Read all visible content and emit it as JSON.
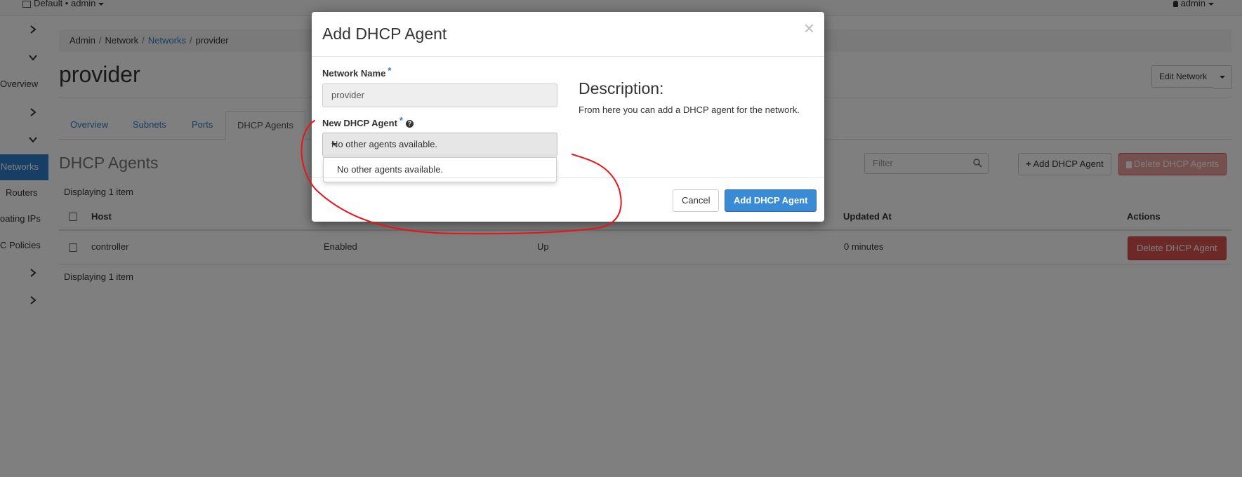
{
  "topbar": {
    "project": "Default • admin",
    "user": "admin"
  },
  "sidebar": {
    "items": [
      {
        "label": "Overview"
      },
      {
        "label": "Networks"
      },
      {
        "label": "Routers"
      },
      {
        "label": "oating IPs"
      },
      {
        "label": "C Policies"
      }
    ]
  },
  "breadcrumb": {
    "items": [
      "Admin",
      "Network",
      "Networks",
      "provider"
    ]
  },
  "page": {
    "title": "provider",
    "edit_button": "Edit Network"
  },
  "tabs": [
    "Overview",
    "Subnets",
    "Ports",
    "DHCP Agents"
  ],
  "section": {
    "title": "DHCP Agents",
    "filter_placeholder": "Filter",
    "add_button": "Add DHCP Agent",
    "delete_button": "Delete DHCP Agents",
    "count_top": "Displaying 1 item",
    "count_bottom": "Displaying 1 item"
  },
  "table": {
    "headers": {
      "host": "Host",
      "updated": "Updated At",
      "actions": "Actions"
    },
    "rows": [
      {
        "host": "controller",
        "status": "Enabled",
        "state": "Up",
        "updated": "0 minutes",
        "action": "Delete DHCP Agent"
      }
    ]
  },
  "modal": {
    "title": "Add DHCP Agent",
    "close": "×",
    "network_label": "Network Name",
    "network_value": "provider",
    "agent_label": "New DHCP Agent",
    "agent_selected": "No other agents available.",
    "agent_options": [
      "No other agents available."
    ],
    "desc_title": "Description:",
    "desc_text": "From here you can add a DHCP agent for the network.",
    "cancel": "Cancel",
    "submit": "Add DHCP Agent",
    "required_mark": "*",
    "help_glyph": "?"
  },
  "annotation_color": "#e8141a"
}
